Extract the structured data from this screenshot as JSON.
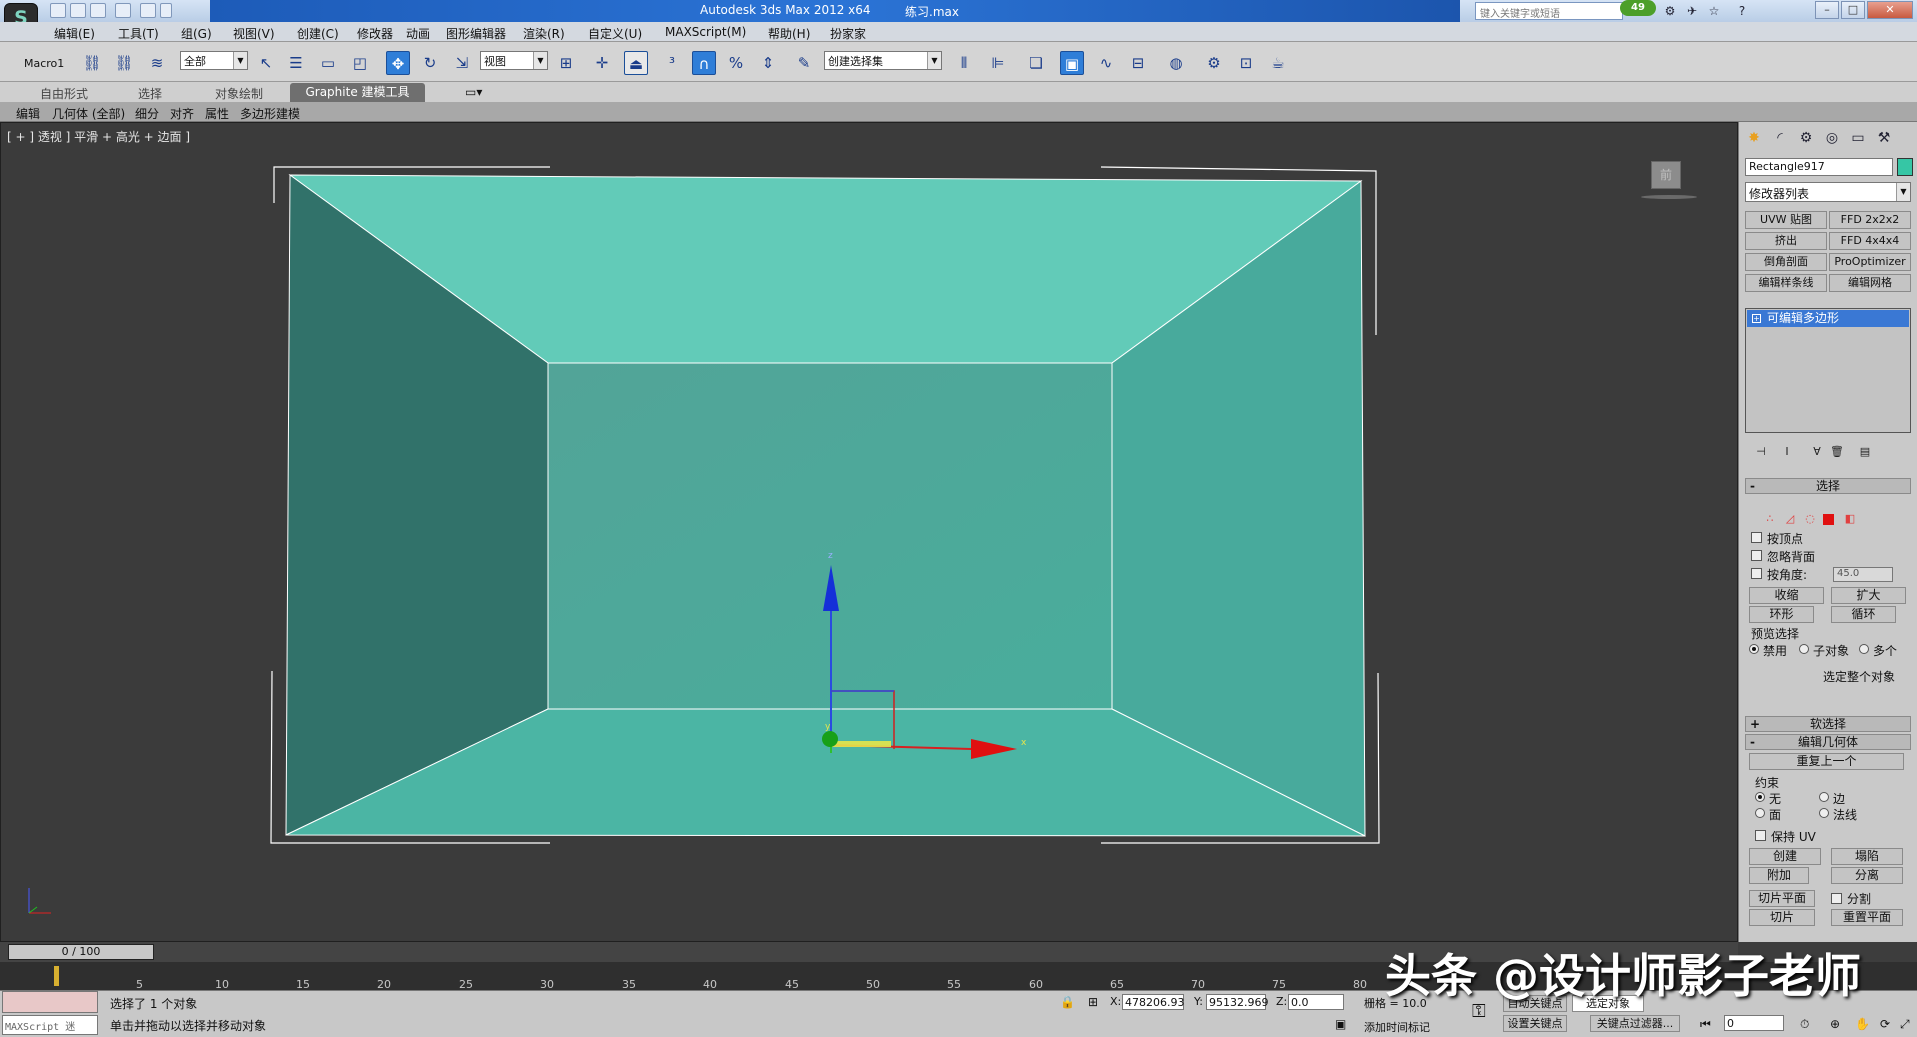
{
  "title": {
    "app": "Autodesk 3ds Max  2012 x64",
    "file": "练习.max",
    "search_placeholder": "键入关键字或短语",
    "badge": "49"
  },
  "menu": [
    "编辑(E)",
    "工具(T)",
    "组(G)",
    "视图(V)",
    "创建(C)",
    "修改器",
    "动画",
    "图形编辑器",
    "渲染(R)",
    "自定义(U)",
    "MAXScript(M)",
    "帮助(H)",
    "扮家家"
  ],
  "toolbar": {
    "macro": "Macro1",
    "filter": "全部",
    "ref_coord": "视图",
    "named_sel": "创建选择集"
  },
  "ribbon": {
    "tabs": [
      "自由形式",
      "选择",
      "对象绘制"
    ],
    "active_tab": "Graphite 建模工具",
    "commands": [
      "编辑",
      "几何体 (全部)",
      "细分",
      "对齐",
      "属性",
      "多边形建模"
    ]
  },
  "viewport": {
    "label": "[ + ] 透视 ] 平滑 + 高光 + 边面 ]",
    "cube": "前",
    "gizmo": {
      "x": "x",
      "y": "y",
      "z": "z"
    }
  },
  "panel": {
    "object_name": "Rectangle917",
    "object_color": "#36c6a5",
    "modifier_list": "修改器列表",
    "mod_buttons": [
      "UVW 贴图",
      "FFD 2x2x2",
      "挤出",
      "FFD 4x4x4",
      "倒角剖面",
      "ProOptimizer",
      "编辑样条线",
      "编辑网格"
    ],
    "stack_item": "可编辑多边形",
    "selection": {
      "rollout": "选择",
      "by_vertex": "按顶点",
      "ignore_backface": "忽略背面",
      "by_angle": "按角度:",
      "angle_value": "45.0",
      "shrink": "收缩",
      "grow": "扩大",
      "ring": "环形",
      "loop": "循环",
      "preview_label": "预览选择",
      "preview_opts": [
        "禁用",
        "子对象",
        "多个"
      ],
      "whole_object": "选定整个对象"
    },
    "soft_selection": "软选择",
    "edit_geometry": {
      "rollout": "编辑几何体",
      "repeat_last": "重复上一个",
      "constraints_label": "约束",
      "constraints": [
        "无",
        "边",
        "面",
        "法线"
      ],
      "preserve_uv": "保持 UV",
      "create": "创建",
      "collapse": "塌陷",
      "attach": "附加",
      "detach": "分离",
      "slice_plane": "切片平面",
      "split": "分割",
      "slice": "切片",
      "reset_plane": "重置平面"
    }
  },
  "timeline": {
    "slider": "0 / 100",
    "ticks": [
      "5",
      "10",
      "15",
      "20",
      "25",
      "30",
      "35",
      "40",
      "45",
      "50",
      "55",
      "60",
      "65",
      "70",
      "75",
      "80"
    ]
  },
  "status": {
    "maxscript": "MAXScript 迷",
    "line1": "选择了 1 个对象",
    "line2": "单击并拖动以选择并移动对象",
    "x_label": "X:",
    "x": "478206.93",
    "y_label": "Y:",
    "y": "95132.969",
    "z_label": "Z:",
    "z": "0.0",
    "grid": "栅格 = 10.0",
    "add_time_tag": "添加时间标记",
    "auto_key": "自动关键点",
    "selected": "选定对象",
    "set_key": "设置关键点",
    "key_filters": "关键点过滤器...",
    "frame": "0"
  },
  "watermark": "头条 @设计师影子老师"
}
